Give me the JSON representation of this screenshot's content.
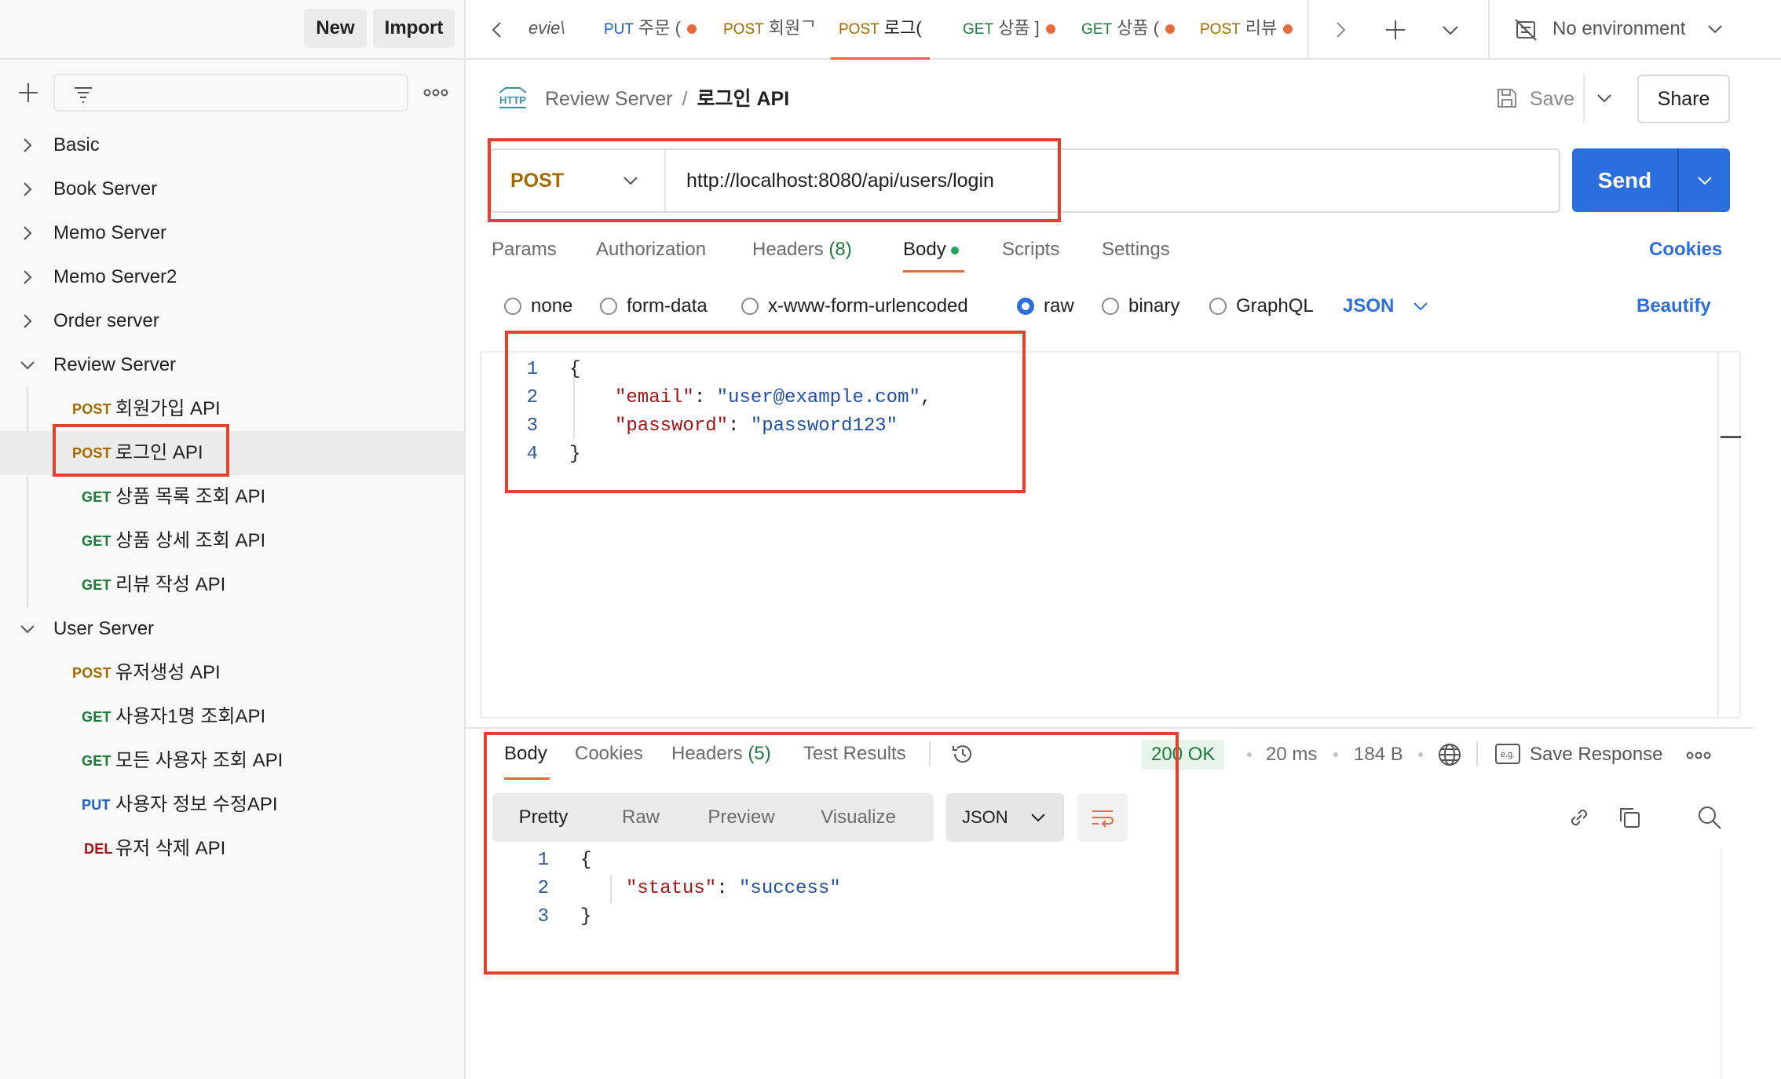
{
  "sidebar": {
    "new_label": "New",
    "import_label": "Import",
    "filter_placeholder": "",
    "folders": [
      {
        "label": "Basic",
        "expanded": false
      },
      {
        "label": "Book Server",
        "expanded": false
      },
      {
        "label": "Memo Server",
        "expanded": false
      },
      {
        "label": "Memo Server2",
        "expanded": false
      },
      {
        "label": "Order server",
        "expanded": false
      },
      {
        "label": "Review Server",
        "expanded": true
      },
      {
        "label": "User Server",
        "expanded": true
      }
    ],
    "review_requests": [
      {
        "method": "POST",
        "name": "회원가입 API"
      },
      {
        "method": "POST",
        "name": "로그인 API"
      },
      {
        "method": "GET",
        "name": "상품 목록 조회 API"
      },
      {
        "method": "GET",
        "name": "상품 상세 조회 API"
      },
      {
        "method": "GET",
        "name": "리뷰 작성 API"
      }
    ],
    "user_requests": [
      {
        "method": "POST",
        "name": "유저생성 API"
      },
      {
        "method": "GET",
        "name": "사용자1명 조회API"
      },
      {
        "method": "GET",
        "name": "모든 사용자 조회 API"
      },
      {
        "method": "PUT",
        "name": "사용자 정보 수정API"
      },
      {
        "method": "DEL",
        "name": "유저 삭제 API"
      }
    ]
  },
  "tabs": [
    {
      "method": "",
      "label": "evie\\",
      "unsaved": false
    },
    {
      "method": "PUT",
      "label": "주문 (",
      "unsaved": true
    },
    {
      "method": "POST",
      "label": "회원ᄀ",
      "unsaved": false
    },
    {
      "method": "POST",
      "label": "로그(",
      "unsaved": false,
      "active": true
    },
    {
      "method": "GET",
      "label": "상품 ]",
      "unsaved": true
    },
    {
      "method": "GET",
      "label": "상품 (",
      "unsaved": true
    },
    {
      "method": "POST",
      "label": "리뷰",
      "unsaved": true
    }
  ],
  "environment": {
    "label": "No environment"
  },
  "header": {
    "http_icon": "HTTP",
    "breadcrumb_parent": "Review Server",
    "breadcrumb_sep": "/",
    "breadcrumb_current": "로그인 API",
    "save_label": "Save",
    "share_label": "Share"
  },
  "request": {
    "method": "POST",
    "url": "http://localhost:8080/api/users/login",
    "send_label": "Send",
    "tabs": [
      {
        "label": "Params"
      },
      {
        "label": "Authorization"
      },
      {
        "label": "Headers",
        "count": "(8)"
      },
      {
        "label": "Body",
        "active": true
      },
      {
        "label": "Scripts"
      },
      {
        "label": "Settings"
      }
    ],
    "cookies_label": "Cookies",
    "body_types": [
      "none",
      "form-data",
      "x-www-form-urlencoded",
      "raw",
      "binary",
      "GraphQL"
    ],
    "body_type_selected": "raw",
    "format": "JSON",
    "beautify_label": "Beautify",
    "body_lines": [
      {
        "n": "1",
        "brace": "{"
      },
      {
        "n": "2",
        "key": "\"email\"",
        "val": "\"user@example.com\"",
        "trail": ","
      },
      {
        "n": "3",
        "key": "\"password\"",
        "val": "\"password123\"",
        "trail": ""
      },
      {
        "n": "4",
        "brace": "}"
      }
    ]
  },
  "response": {
    "tabs": [
      {
        "label": "Body",
        "active": true
      },
      {
        "label": "Cookies"
      },
      {
        "label": "Headers",
        "count": "(5)"
      },
      {
        "label": "Test Results"
      }
    ],
    "status": "200 OK",
    "time": "20 ms",
    "size": "184 B",
    "eg_icon": "e.g.",
    "save_response_label": "Save Response",
    "views": [
      "Pretty",
      "Raw",
      "Preview",
      "Visualize"
    ],
    "view_selected": "Pretty",
    "format": "JSON",
    "body_lines": [
      {
        "n": "1",
        "brace": "{"
      },
      {
        "n": "2",
        "key": "\"status\"",
        "val": "\"success\""
      },
      {
        "n": "3",
        "brace": "}"
      }
    ]
  },
  "colors": {
    "accent_orange": "#e8693a",
    "send_blue": "#2b6fde",
    "post": "#a46a00",
    "get": "#1f7a3a",
    "put": "#1f5fc4",
    "del": "#a31515",
    "annotation_red": "#e3402e"
  }
}
